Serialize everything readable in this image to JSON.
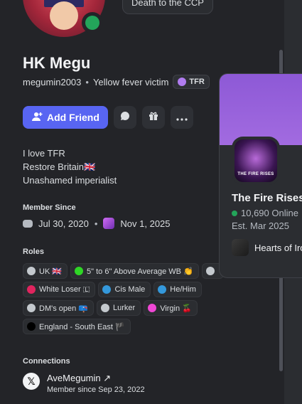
{
  "profile": {
    "custom_status": "Death to the CCP",
    "display_name": "HK Megu",
    "username": "megumin2003",
    "pronouns": "Yellow fever victim",
    "server_tag": "TFR",
    "bio": [
      "I love TFR",
      "Restore Britain🇬🇧",
      "Unashamed imperialist"
    ]
  },
  "actions": {
    "add_friend": "Add Friend",
    "message_icon": "💬",
    "gift_icon": "🎁",
    "more_icon": "···"
  },
  "member_since": {
    "title": "Member Since",
    "discord_date": "Jul 30, 2020",
    "separator": "•",
    "server_date": "Nov 1, 2025"
  },
  "roles": {
    "title": "Roles",
    "items": [
      {
        "label": "UK 🇬🇧",
        "color": "#c4c9ce"
      },
      {
        "label": "5\" to 6\" Above Average WB 👏",
        "color": "#2fd626"
      },
      {
        "label": "",
        "color": "#c4c9ce"
      },
      {
        "label": "White Loser 🇱",
        "color": "#e0245e"
      },
      {
        "label": "Cis Male",
        "color": "#3498db"
      },
      {
        "label": "He/Him",
        "color": "#3498db"
      },
      {
        "label": "DM's open 📪",
        "color": "#c4c9ce"
      },
      {
        "label": "Lurker",
        "color": "#c4c9ce"
      },
      {
        "label": "Virgin 🍒",
        "color": "#f047d5"
      },
      {
        "label": "England - South East 🏴",
        "color": "#000000"
      }
    ]
  },
  "connections": {
    "title": "Connections",
    "account": "AveMegumin ↗",
    "since": "Member since Sep 23, 2022"
  },
  "server_popout": {
    "icon_text": "THE FIRE RISES",
    "name": "The Fire Rises",
    "online": "10,690 Online",
    "established": "Est. Mar 2025",
    "channel": "Hearts of Iron"
  }
}
